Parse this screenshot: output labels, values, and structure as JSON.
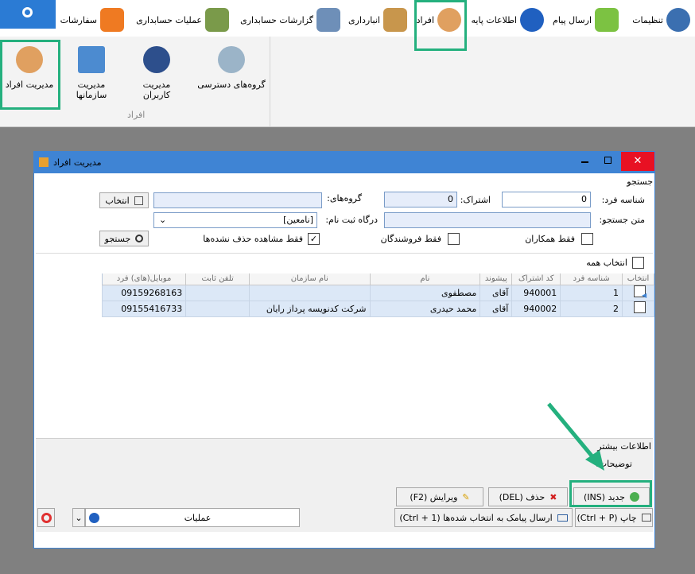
{
  "ribbon": {
    "tabs": [
      {
        "label": "تنظیمات",
        "icon": "gear-icon",
        "color": "#3b6fb0"
      },
      {
        "label": "ارسال پیام",
        "icon": "chat-icon",
        "color": "#7cc242"
      },
      {
        "label": "اطلاعات پایه",
        "icon": "info-icon",
        "color": "#2060c0"
      },
      {
        "label": "افراد",
        "icon": "person-icon",
        "color": "#e0a060"
      },
      {
        "label": "انبارداری",
        "icon": "box-icon",
        "color": "#c8964c"
      },
      {
        "label": "گزارشات حسابداری",
        "icon": "ledger-icon",
        "color": "#6e8fb8"
      },
      {
        "label": "عملیات حسابداری",
        "icon": "accounting-icon",
        "color": "#7a9a4a"
      },
      {
        "label": "سفارشات",
        "icon": "orders-icon",
        "color": "#ef7a22"
      }
    ],
    "group": {
      "title": "افراد",
      "items": [
        {
          "label": "مدیریت افراد",
          "icon": "person-icon"
        },
        {
          "label": "مدیریت سازمانها",
          "icon": "building-icon"
        },
        {
          "label": "مدیریت کاربران",
          "icon": "user-icon"
        },
        {
          "label": "گروه‌های دسترسی",
          "icon": "keys-icon"
        }
      ]
    }
  },
  "window": {
    "title": "مدیریت افراد",
    "search_section": "جستجو",
    "fields": {
      "person_id_label": "شناسه فرد:",
      "person_id_value": "0",
      "subscription_label": "اشتراک:",
      "subscription_value": "0",
      "groups_label": "گروه‌های:",
      "groups_value": "",
      "select_button": "انتخاب",
      "search_text_label": "متن جستجو:",
      "search_text_value": "",
      "reg_portal_label": "درگاه ثبت نام:",
      "reg_portal_value": "[نامعین]",
      "search_button": "جستجو"
    },
    "checkboxes": {
      "colleagues_only": "فقط همکاران",
      "sellers_only": "فقط فروشندگان",
      "not_deleted_only": "فقط مشاهده حذف نشده‌ها",
      "select_all": "انتخاب همه"
    },
    "table": {
      "columns": [
        "انتخاب",
        "شناسه فرد",
        "کد اشتراک",
        "پیشوند",
        "نام",
        "نام سازمان",
        "تلفن ثابت",
        "موبایل(های) فرد"
      ],
      "rows": [
        {
          "id": "1",
          "code": "940001",
          "prefix": "آقای",
          "name": "مصطفوی",
          "org": "",
          "phone": "",
          "mobile": "09159268163"
        },
        {
          "id": "2",
          "code": "940002",
          "prefix": "آقای",
          "name": "محمد حیدری",
          "org": "شرکت کدنویسه پرداز رایان",
          "phone": "",
          "mobile": "09155416733"
        }
      ]
    },
    "more_info": "اطلاعات بیشتر",
    "description_label": "توضیحات:",
    "buttons": {
      "new": "جدید (INS)",
      "delete": "حذف (DEL)",
      "edit": "ویرایش (F2)",
      "print": "چاپ (Ctrl + P)",
      "sms": "ارسال پیامک به انتخاب شده‌ها (Ctrl + 1)",
      "operations": "عملیات"
    }
  },
  "colors": {
    "accent": "#3f84d4",
    "highlight": "#24b07e",
    "row_selected": "#dce8f7"
  }
}
